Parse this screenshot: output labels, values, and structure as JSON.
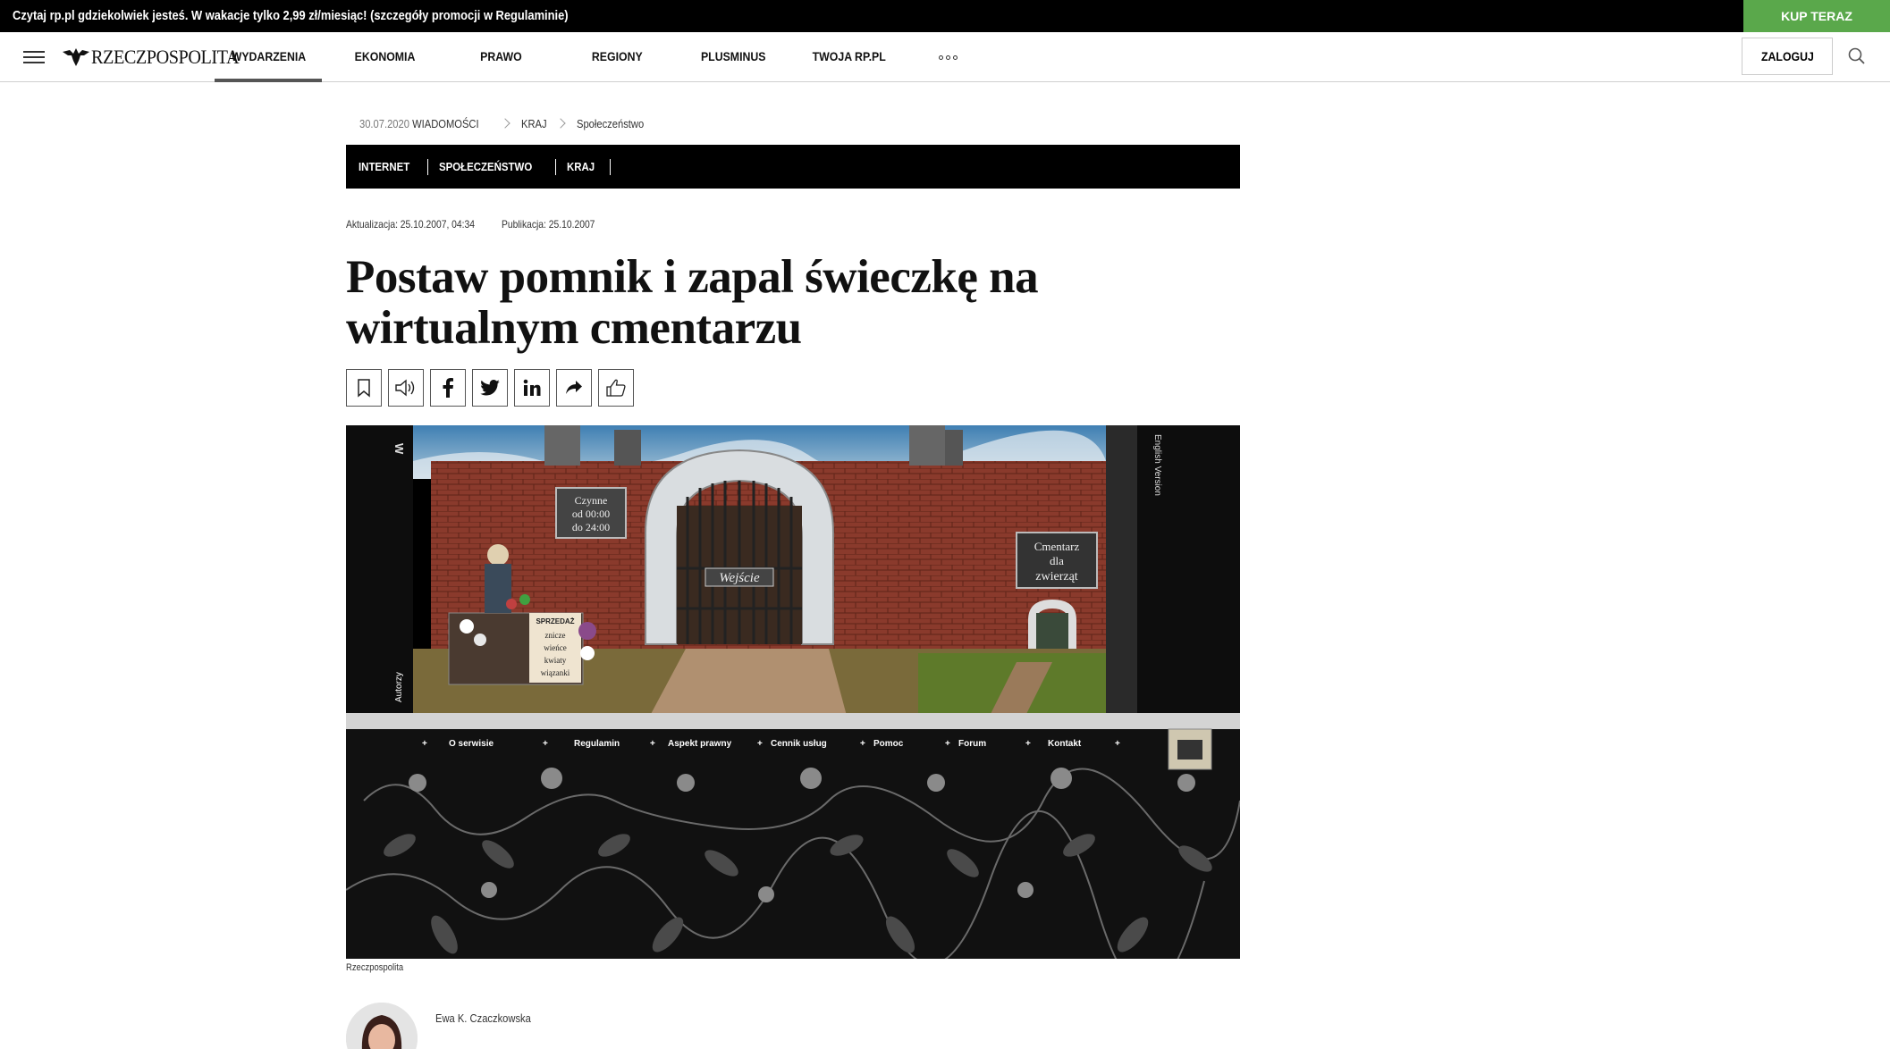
{
  "promo": {
    "text": "Czytaj rp.pl gdziekolwiek jesteś. W wakacje tylko 2,99 zł/miesiąc! (szczegóły promocji w Regulaminie)",
    "button": "KUP TERAZ",
    "button_color": "#5aa84b"
  },
  "nav": {
    "logo": "RZECZPOSPOLITA",
    "items": [
      {
        "label": "WYDARZENIA",
        "active": true
      },
      {
        "label": "EKONOMIA"
      },
      {
        "label": "PRAWO"
      },
      {
        "label": "REGIONY"
      },
      {
        "label": "PLUSMINUS"
      },
      {
        "label": "TWOJA RP.PL"
      }
    ],
    "login": "ZALOGUJ",
    "icons": [
      "menu-icon",
      "more-icon",
      "search-icon"
    ]
  },
  "breadcrumb": {
    "date": "30.07.2020",
    "section": "WIADOMOŚCI",
    "items": [
      "KRAJ",
      "Społeczeństwo"
    ]
  },
  "tags": [
    "INTERNET",
    "SPOŁECZEŃSTWO",
    "KRAJ"
  ],
  "dates": {
    "updated": "Aktualizacja: 25.10.2007, 04:34",
    "published": "Publikacja: 25.10.2007"
  },
  "article": {
    "title": "Postaw pomnik i zapal świeczkę na wirtualnym cmentarzu",
    "caption": "Rzeczpospolita",
    "author": "Ewa K. Czaczkowska"
  },
  "share_icons": [
    "bookmark-icon",
    "speaker-icon",
    "facebook-icon",
    "twitter-icon",
    "linkedin-icon",
    "share-icon",
    "thumbs-up-icon"
  ],
  "hero_image": {
    "sign_hours": "Czynne 00:00 do 24:00",
    "gate_label": "Wejście",
    "side_sign": "Cmentarz dla zwierząt",
    "stall": [
      "SPRZEDAŻ",
      "znicze",
      "wieńce",
      "kwiaty",
      "wiązanki"
    ],
    "side_left": "Autorzy",
    "side_right": "English Version",
    "menu": [
      "O serwisie",
      "Regulamin",
      "Aspekt prawny",
      "Cennik usług",
      "Pomoc",
      "Forum",
      "Kontakt"
    ]
  }
}
